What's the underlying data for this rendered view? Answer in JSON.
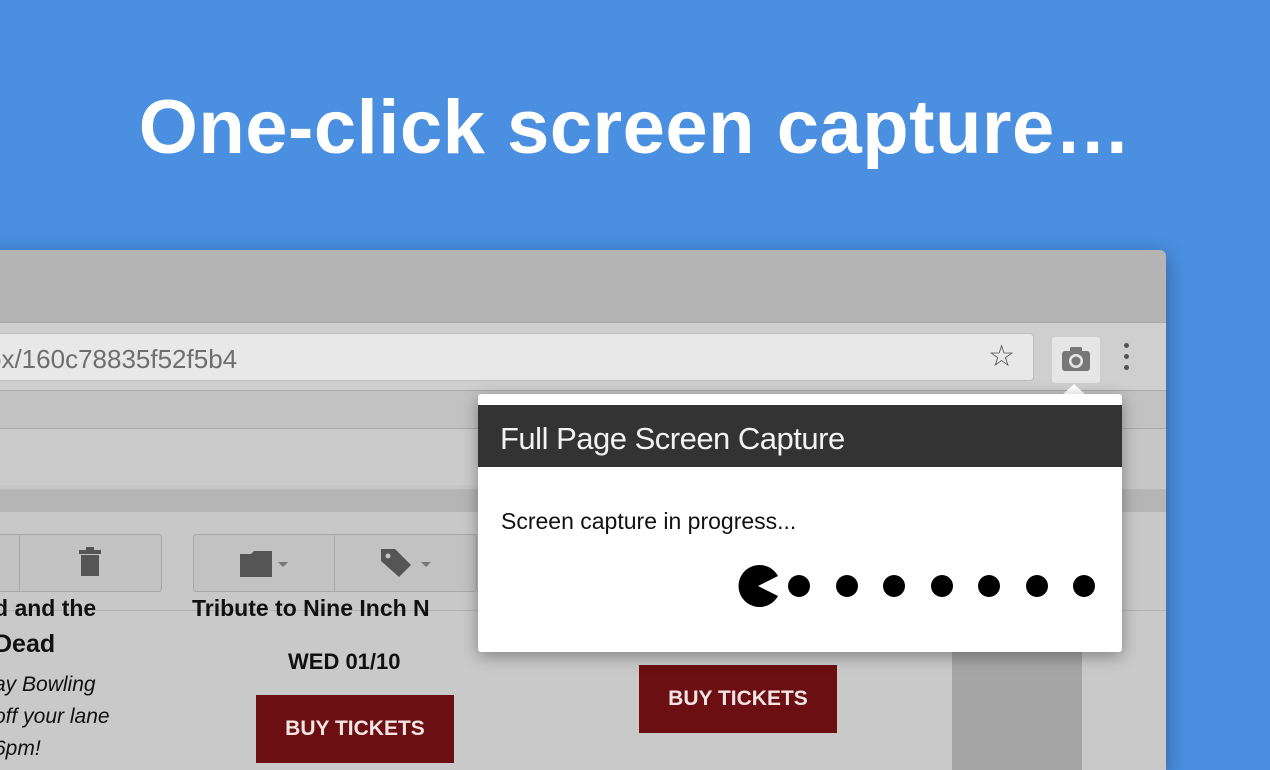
{
  "headline": "One-click screen capture…",
  "browser": {
    "address_text": "ox/160c78835f52f5b4",
    "icons": [
      "star-icon",
      "camera-icon",
      "more-vert-icon",
      "trash-icon",
      "folder-icon",
      "tag-icon",
      "chevron-down-icon"
    ]
  },
  "page_content": {
    "events": [
      {
        "title_line1": "d and the",
        "title_line2": "Dead",
        "venue_line1": "ay Bowling",
        "venue_line2": "off your lane",
        "venue_line3": "6pm!"
      },
      {
        "title_line1": "Tribute to Nine Inch N",
        "date": "WED 01/10",
        "button": "BUY TICKETS"
      },
      {
        "button": "BUY TICKETS"
      }
    ]
  },
  "popup": {
    "title": "Full Page Screen Capture",
    "status": "Screen capture in progress...",
    "progress_icon": "pacman-icon",
    "remaining_dots": 7
  },
  "colors": {
    "background": "#4a8fe0",
    "popup_header": "#333333",
    "buy_button": "#6b0f12"
  }
}
